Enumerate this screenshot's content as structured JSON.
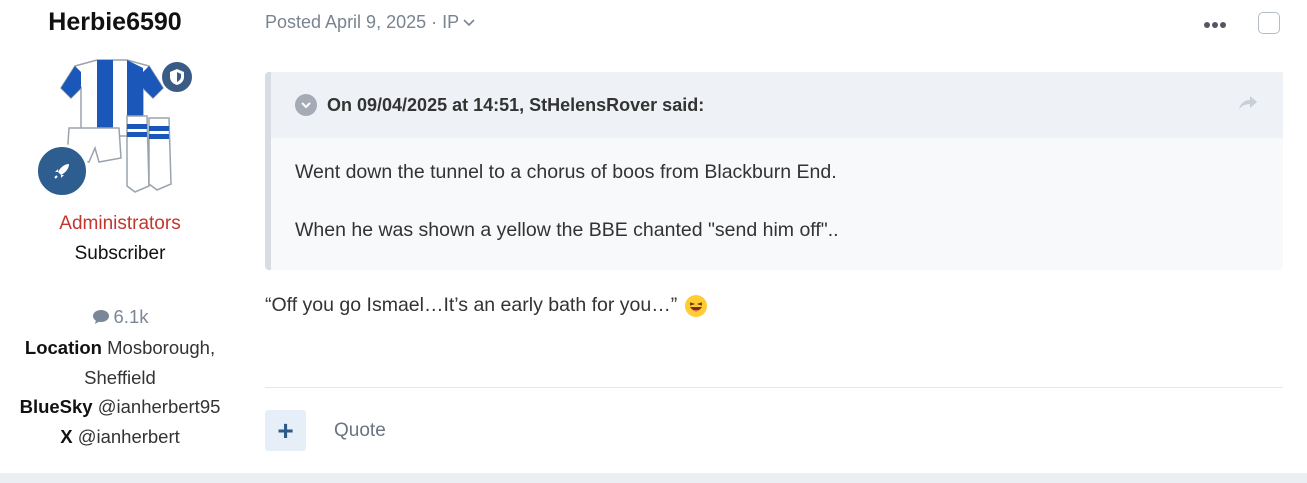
{
  "author": {
    "username": "Herbie6590",
    "group": "Administrators",
    "subscription": "Subscriber",
    "post_count": "6.1k",
    "location_label": "Location",
    "location_value_line1": "Mosborough,",
    "location_value_line2": "Sheffield",
    "bluesky_label": "BlueSky",
    "bluesky_value": "@ianherbert95",
    "x_label": "X",
    "x_value": "@ianherbert"
  },
  "post": {
    "posted_text": "Posted April 9, 2025 · IP",
    "quote": {
      "citation": "On 09/04/2025 at 14:51, StHelensRover said:",
      "paragraphs": [
        "Went down the tunnel to a chorus of boos from Blackburn End.",
        "When he was shown a yellow the BBE chanted \"send him off\".."
      ]
    },
    "content": "“Off you go Ismael…It’s an early bath for you…”",
    "actions": {
      "plus_label": "+",
      "quote_label": "Quote"
    }
  },
  "colors": {
    "admin_group": "#c3352f",
    "accent": "#2e5d8f"
  }
}
